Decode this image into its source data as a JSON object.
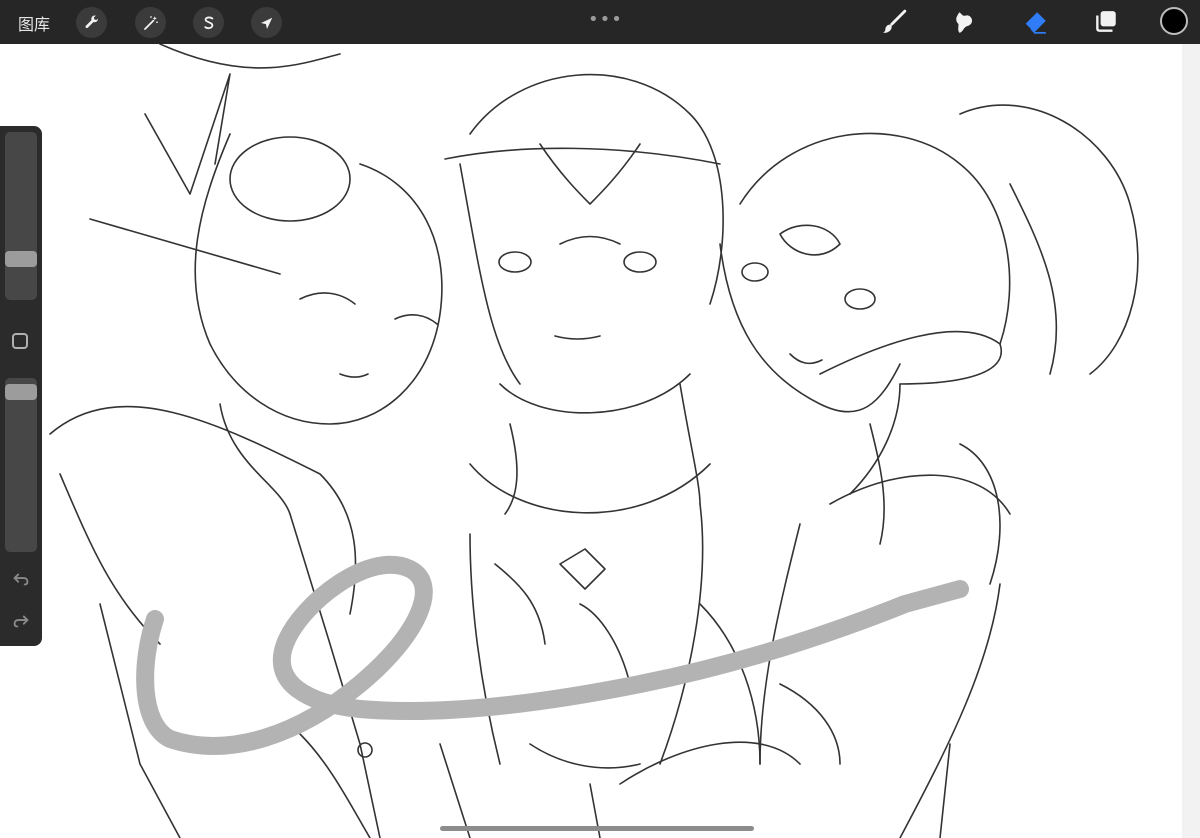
{
  "toolbar": {
    "gallery_label": "图库",
    "left_tools": [
      {
        "icon": "wrench-icon",
        "name": "actions-button"
      },
      {
        "icon": "magic-wand-icon",
        "name": "adjustments-button"
      },
      {
        "icon": "selection-s-icon",
        "name": "selection-button"
      },
      {
        "icon": "arrow-cursor-icon",
        "name": "transform-button"
      }
    ],
    "more_dots": "•••",
    "right_tools": [
      {
        "icon": "brush-icon",
        "name": "paint-brush-button"
      },
      {
        "icon": "smudge-icon",
        "name": "smudge-button"
      },
      {
        "icon": "eraser-icon",
        "name": "eraser-button",
        "active": true
      },
      {
        "icon": "layers-icon",
        "name": "layers-button"
      }
    ],
    "active_color": "#000000",
    "accent_color": "#2f7cf6"
  },
  "sidebar": {
    "brush_size_level": 0.22,
    "opacity_level": 0.96
  },
  "canvas": {
    "background": "#ffffff",
    "stroke_color": "#b3b3b3"
  }
}
